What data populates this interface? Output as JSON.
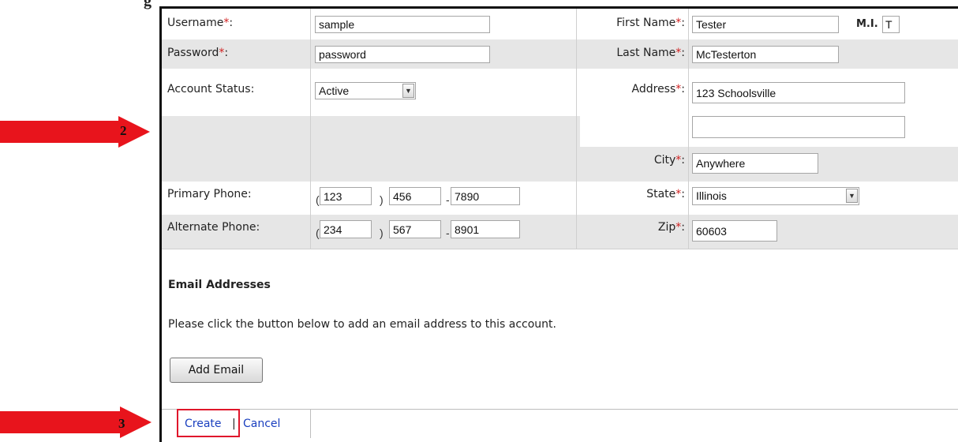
{
  "stray_text": "g",
  "form": {
    "username": {
      "label": "Username",
      "req": "*",
      "colon": ":",
      "value": "sample"
    },
    "password": {
      "label": "Password",
      "req": "*",
      "colon": ":",
      "value": "password"
    },
    "account_status": {
      "label": "Account Status:",
      "value": "Active"
    },
    "primary_phone": {
      "label": "Primary Phone:",
      "area": "123",
      "prefix": "456",
      "line": "7890"
    },
    "alternate_phone": {
      "label": "Alternate Phone:",
      "area": "234",
      "prefix": "567",
      "line": "8901"
    },
    "first_name": {
      "label": "First Name",
      "req": "*",
      "colon": ":",
      "value": "Tester"
    },
    "mi": {
      "label": "M.I.",
      "value": "T"
    },
    "last_name": {
      "label": "Last Name",
      "req": "*",
      "colon": ":",
      "value": "McTesterton"
    },
    "address": {
      "label": "Address",
      "req": "*",
      "colon": ":",
      "value": "123 Schoolsville",
      "value2": ""
    },
    "city": {
      "label": "City",
      "req": "*",
      "colon": ":",
      "value": "Anywhere"
    },
    "state": {
      "label": "State",
      "req": "*",
      "colon": ":",
      "value": "Illinois"
    },
    "zip": {
      "label": "Zip",
      "req": "*",
      "colon": ":",
      "value": "60603"
    },
    "phone_open": "(",
    "phone_close": ")",
    "phone_dash": "-"
  },
  "email": {
    "title": "Email Addresses",
    "help": "Please click the button below to add an email address to this account.",
    "add_button": "Add Email"
  },
  "footer": {
    "create": "Create",
    "separator": "|",
    "cancel": "Cancel"
  },
  "annotations": [
    {
      "number": "2",
      "color": "#e8141c"
    },
    {
      "number": "3",
      "color": "#e8141c"
    }
  ],
  "colors": {
    "required": "#d02020",
    "link": "#1a3fbf",
    "row_shade": "#e6e6e6",
    "highlight_box": "#e0162b"
  }
}
